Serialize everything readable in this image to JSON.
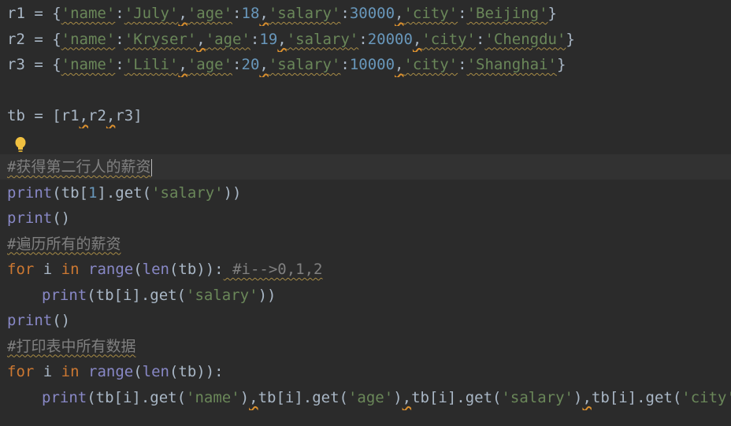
{
  "theme": {
    "background": "#2b2b2b",
    "current_line": "#323232",
    "default": "#a9b7c6",
    "string": "#6a8759",
    "number": "#6897bb",
    "keyword": "#cc7832",
    "builtin": "#8888c6",
    "comment": "#808080",
    "warning_underline": "#d98f2e",
    "bulb": "#f0c040"
  },
  "gutter_icon": "intention-bulb-icon",
  "lines": [
    {
      "indent": 0,
      "tokens": [
        {
          "t": "r1",
          "k": "ident"
        },
        {
          "t": " = {",
          "k": "punct"
        },
        {
          "t": "'name'",
          "k": "str",
          "w": 1
        },
        {
          "t": ":",
          "k": "punct"
        },
        {
          "t": "'July'",
          "k": "str",
          "w": 1
        },
        {
          "t": ",",
          "k": "punct",
          "c": 1
        },
        {
          "t": "'age'",
          "k": "str",
          "w": 1
        },
        {
          "t": ":",
          "k": "punct"
        },
        {
          "t": "18",
          "k": "num"
        },
        {
          "t": ",",
          "k": "punct",
          "c": 1
        },
        {
          "t": "'salary'",
          "k": "str",
          "w": 1
        },
        {
          "t": ":",
          "k": "punct"
        },
        {
          "t": "30000",
          "k": "num"
        },
        {
          "t": ",",
          "k": "punct",
          "c": 1
        },
        {
          "t": "'city'",
          "k": "str",
          "w": 1
        },
        {
          "t": ":",
          "k": "punct"
        },
        {
          "t": "'Beijing'",
          "k": "str",
          "w": 1
        },
        {
          "t": "}",
          "k": "punct"
        }
      ]
    },
    {
      "indent": 0,
      "tokens": [
        {
          "t": "r2",
          "k": "ident"
        },
        {
          "t": " = {",
          "k": "punct"
        },
        {
          "t": "'name'",
          "k": "str",
          "w": 1
        },
        {
          "t": ":",
          "k": "punct"
        },
        {
          "t": "'Kryser'",
          "k": "str",
          "w": 1
        },
        {
          "t": ",",
          "k": "punct",
          "c": 1
        },
        {
          "t": "'age'",
          "k": "str",
          "w": 1
        },
        {
          "t": ":",
          "k": "punct"
        },
        {
          "t": "19",
          "k": "num"
        },
        {
          "t": ",",
          "k": "punct",
          "c": 1
        },
        {
          "t": "'salary'",
          "k": "str",
          "w": 1
        },
        {
          "t": ":",
          "k": "punct"
        },
        {
          "t": "20000",
          "k": "num"
        },
        {
          "t": ",",
          "k": "punct",
          "c": 1
        },
        {
          "t": "'city'",
          "k": "str",
          "w": 1
        },
        {
          "t": ":",
          "k": "punct"
        },
        {
          "t": "'Chengdu'",
          "k": "str",
          "w": 1
        },
        {
          "t": "}",
          "k": "punct"
        }
      ]
    },
    {
      "indent": 0,
      "tokens": [
        {
          "t": "r3",
          "k": "ident"
        },
        {
          "t": " = {",
          "k": "punct"
        },
        {
          "t": "'name'",
          "k": "str",
          "w": 1
        },
        {
          "t": ":",
          "k": "punct"
        },
        {
          "t": "'Lili'",
          "k": "str",
          "w": 1
        },
        {
          "t": ",",
          "k": "punct",
          "c": 1
        },
        {
          "t": "'age'",
          "k": "str",
          "w": 1
        },
        {
          "t": ":",
          "k": "punct"
        },
        {
          "t": "20",
          "k": "num"
        },
        {
          "t": ",",
          "k": "punct",
          "c": 1
        },
        {
          "t": "'salary'",
          "k": "str",
          "w": 1
        },
        {
          "t": ":",
          "k": "punct"
        },
        {
          "t": "10000",
          "k": "num"
        },
        {
          "t": ",",
          "k": "punct",
          "c": 1
        },
        {
          "t": "'city'",
          "k": "str",
          "w": 1
        },
        {
          "t": ":",
          "k": "punct"
        },
        {
          "t": "'Shanghai'",
          "k": "str",
          "w": 1
        },
        {
          "t": "}",
          "k": "punct"
        }
      ]
    },
    {
      "indent": 0,
      "tokens": []
    },
    {
      "indent": 0,
      "tokens": [
        {
          "t": "tb",
          "k": "ident"
        },
        {
          "t": " = [",
          "k": "punct"
        },
        {
          "t": "r1",
          "k": "ident"
        },
        {
          "t": ",",
          "k": "punct",
          "c": 1
        },
        {
          "t": "r2",
          "k": "ident"
        },
        {
          "t": ",",
          "k": "punct",
          "c": 1
        },
        {
          "t": "r3",
          "k": "ident"
        },
        {
          "t": "]",
          "k": "punct"
        }
      ]
    },
    {
      "indent": 0,
      "tokens": []
    },
    {
      "indent": 0,
      "current": true,
      "caret": true,
      "tokens": [
        {
          "t": "#获得第二行人的薪资",
          "k": "comment",
          "w": 1
        }
      ]
    },
    {
      "indent": 0,
      "tokens": [
        {
          "t": "print",
          "k": "builtin"
        },
        {
          "t": "(tb[",
          "k": "punct"
        },
        {
          "t": "1",
          "k": "num"
        },
        {
          "t": "].get(",
          "k": "punct"
        },
        {
          "t": "'salary'",
          "k": "str"
        },
        {
          "t": "))",
          "k": "punct"
        }
      ]
    },
    {
      "indent": 0,
      "tokens": [
        {
          "t": "print",
          "k": "builtin"
        },
        {
          "t": "()",
          "k": "punct"
        }
      ]
    },
    {
      "indent": 0,
      "tokens": [
        {
          "t": "#遍历所有的薪资",
          "k": "comment",
          "w": 1
        }
      ]
    },
    {
      "indent": 0,
      "tokens": [
        {
          "t": "for",
          "k": "kw"
        },
        {
          "t": " i ",
          "k": "ident"
        },
        {
          "t": "in",
          "k": "kw"
        },
        {
          "t": " ",
          "k": "punct"
        },
        {
          "t": "range",
          "k": "builtin"
        },
        {
          "t": "(",
          "k": "punct"
        },
        {
          "t": "len",
          "k": "builtin"
        },
        {
          "t": "(tb)):",
          "k": "punct"
        },
        {
          "t": " #i-->0,1,2",
          "k": "comment",
          "w": 1
        }
      ]
    },
    {
      "indent": 1,
      "tokens": [
        {
          "t": "print",
          "k": "builtin"
        },
        {
          "t": "(tb[i].get(",
          "k": "punct"
        },
        {
          "t": "'salary'",
          "k": "str"
        },
        {
          "t": "))",
          "k": "punct"
        }
      ]
    },
    {
      "indent": 0,
      "tokens": [
        {
          "t": "print",
          "k": "builtin"
        },
        {
          "t": "()",
          "k": "punct"
        }
      ]
    },
    {
      "indent": 0,
      "tokens": [
        {
          "t": "#打印表中所有数据",
          "k": "comment",
          "w": 1
        }
      ]
    },
    {
      "indent": 0,
      "tokens": [
        {
          "t": "for",
          "k": "kw"
        },
        {
          "t": " i ",
          "k": "ident"
        },
        {
          "t": "in",
          "k": "kw"
        },
        {
          "t": " ",
          "k": "punct"
        },
        {
          "t": "range",
          "k": "builtin"
        },
        {
          "t": "(",
          "k": "punct"
        },
        {
          "t": "len",
          "k": "builtin"
        },
        {
          "t": "(tb)):",
          "k": "punct"
        }
      ]
    },
    {
      "indent": 1,
      "tokens": [
        {
          "t": "print",
          "k": "builtin"
        },
        {
          "t": "(tb[i].get(",
          "k": "punct"
        },
        {
          "t": "'name'",
          "k": "str"
        },
        {
          "t": ")",
          "k": "punct"
        },
        {
          "t": ",",
          "k": "punct",
          "c": 1
        },
        {
          "t": "tb[i].get(",
          "k": "punct"
        },
        {
          "t": "'age'",
          "k": "str"
        },
        {
          "t": ")",
          "k": "punct"
        },
        {
          "t": ",",
          "k": "punct",
          "c": 1
        },
        {
          "t": "tb[i].get(",
          "k": "punct"
        },
        {
          "t": "'salary'",
          "k": "str"
        },
        {
          "t": ")",
          "k": "punct"
        },
        {
          "t": ",",
          "k": "punct",
          "c": 1
        },
        {
          "t": "tb[i].get(",
          "k": "punct"
        },
        {
          "t": "'city'",
          "k": "str"
        },
        {
          "t": "))",
          "k": "punct"
        }
      ]
    }
  ]
}
